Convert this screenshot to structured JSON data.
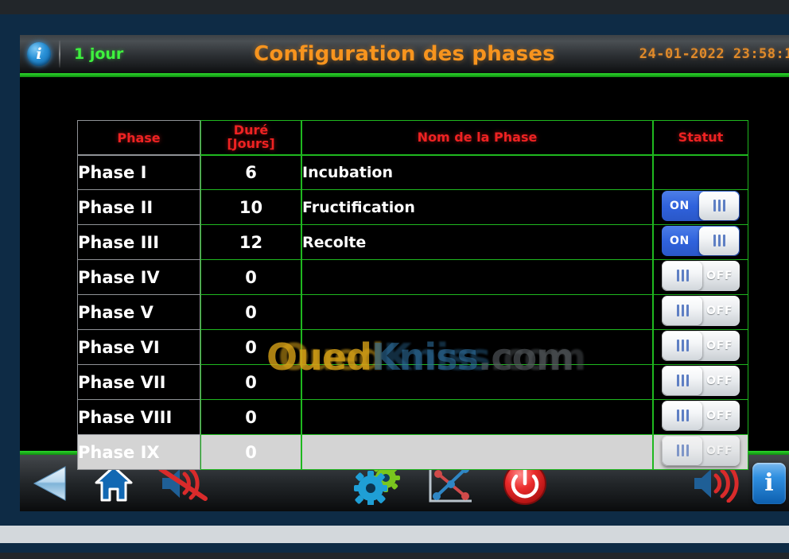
{
  "header": {
    "info_icon": "info-icon",
    "day_label": "1 jour",
    "title": "Configuration des phases",
    "datetime": "24-01-2022 23:58:1"
  },
  "table": {
    "columns": [
      {
        "key": "phase",
        "label": "Phase"
      },
      {
        "key": "duree",
        "label": "Duré",
        "sub": "[Jours]"
      },
      {
        "key": "nom",
        "label": "Nom de la Phase"
      },
      {
        "key": "statut",
        "label": "Statut"
      }
    ],
    "rows": [
      {
        "phase": "Phase I",
        "duree": "6",
        "nom": "Incubation",
        "statut": "",
        "has_toggle": false,
        "disabled": false
      },
      {
        "phase": "Phase II",
        "duree": "10",
        "nom": "Fructification",
        "statut": "ON",
        "has_toggle": true,
        "on": true,
        "disabled": false
      },
      {
        "phase": "Phase III",
        "duree": "12",
        "nom": "Recolte",
        "statut": "ON",
        "has_toggle": true,
        "on": true,
        "disabled": false
      },
      {
        "phase": "Phase IV",
        "duree": "0",
        "nom": "",
        "statut": "OFF",
        "has_toggle": true,
        "on": false,
        "disabled": false
      },
      {
        "phase": "Phase V",
        "duree": "0",
        "nom": "",
        "statut": "OFF",
        "has_toggle": true,
        "on": false,
        "disabled": false
      },
      {
        "phase": "Phase VI",
        "duree": "0",
        "nom": "",
        "statut": "OFF",
        "has_toggle": true,
        "on": false,
        "disabled": false
      },
      {
        "phase": "Phase VII",
        "duree": "0",
        "nom": "",
        "statut": "OFF",
        "has_toggle": true,
        "on": false,
        "disabled": false
      },
      {
        "phase": "Phase VIII",
        "duree": "0",
        "nom": "",
        "statut": "OFF",
        "has_toggle": true,
        "on": false,
        "disabled": false
      },
      {
        "phase": "Phase IX",
        "duree": "0",
        "nom": "",
        "statut": "OFF",
        "has_toggle": true,
        "on": false,
        "disabled": true
      }
    ]
  },
  "watermark": {
    "part1": "Oued",
    "part2": "Kniss",
    "part3": ".com"
  },
  "toolbar": {
    "items": [
      {
        "name": "back-icon",
        "label": "back"
      },
      {
        "name": "home-icon",
        "label": "home"
      },
      {
        "name": "speaker-mute-icon",
        "label": "mute"
      },
      {
        "name": "settings-gears-icon",
        "label": "settings"
      },
      {
        "name": "chart-icon",
        "label": "graph"
      },
      {
        "name": "power-icon",
        "label": "power"
      },
      {
        "name": "speaker-on-icon",
        "label": "sound"
      },
      {
        "name": "info-icon",
        "label": "info"
      }
    ],
    "info_glyph": "i"
  },
  "colors": {
    "accent_title": "#f7941e",
    "accent_green": "#3ef23e",
    "grid_green": "#1fb81f",
    "grid_gray": "#8f9296",
    "header_red": "#ee2222",
    "toggle_on": "#2f62dc",
    "toggle_off": "#e6e9ec",
    "bezel": "#0e2b45",
    "datetime": "#e08a2a"
  }
}
